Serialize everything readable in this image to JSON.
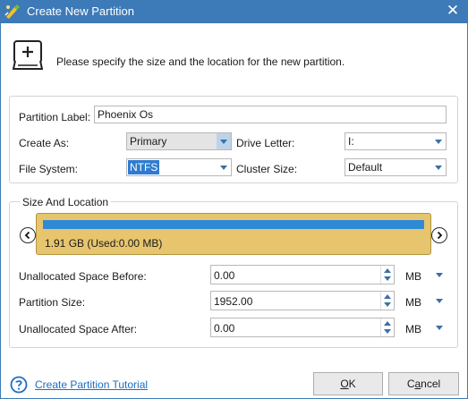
{
  "window": {
    "title": "Create New Partition",
    "close_glyph": "✕"
  },
  "header": {
    "icon": "add-disk-icon",
    "instruction": "Please specify the size and the location for the new partition."
  },
  "form": {
    "partition_label": {
      "label": "Partition Label:",
      "value": "Phoenix Os"
    },
    "create_as": {
      "label": "Create As:",
      "value": "Primary"
    },
    "drive_letter": {
      "label": "Drive Letter:",
      "value": "I:"
    },
    "file_system": {
      "label": "File System:",
      "value": "NTFS"
    },
    "cluster_size": {
      "label": "Cluster Size:",
      "value": "Default"
    }
  },
  "size_location": {
    "legend": "Size And Location",
    "disk_text": "1.91 GB (Used:0.00 MB)",
    "used_fraction": 0,
    "unallocated_before": {
      "label": "Unallocated Space Before:",
      "value": "0.00",
      "unit": "MB"
    },
    "partition_size": {
      "label": "Partition Size:",
      "value": "1952.00",
      "unit": "MB"
    },
    "unallocated_after": {
      "label": "Unallocated Space After:",
      "value": "0.00",
      "unit": "MB"
    }
  },
  "footer": {
    "tutorial_link": "Create Partition Tutorial",
    "ok_accel": "O",
    "ok_rest": "K",
    "cancel_first": "C",
    "cancel_accel": "a",
    "cancel_rest": "ncel"
  },
  "colors": {
    "titlebar": "#3d7ab8",
    "disk_bar": "#e7c56e",
    "used_bar": "#2f8ad6",
    "link": "#1b6ec2"
  }
}
